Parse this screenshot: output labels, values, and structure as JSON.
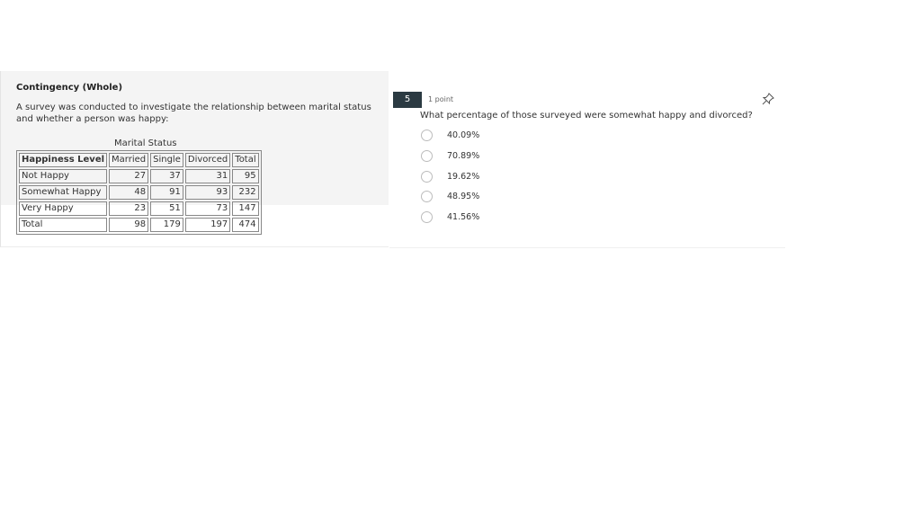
{
  "stimulus": {
    "title": "Contingency (Whole)",
    "description": "A survey was conducted to investigate the relationship between marital status and whether a person was happy:",
    "table_caption": "Marital Status",
    "columns": [
      "Happiness Level",
      "Married",
      "Single",
      "Divorced",
      "Total"
    ],
    "rows": [
      {
        "label": "Not Happy",
        "married": "27",
        "single": "37",
        "divorced": "31",
        "total": "95"
      },
      {
        "label": "Somewhat Happy",
        "married": "48",
        "single": "91",
        "divorced": "93",
        "total": "232"
      },
      {
        "label": "Very Happy",
        "married": "23",
        "single": "51",
        "divorced": "73",
        "total": "147"
      },
      {
        "label": "Total",
        "married": "98",
        "single": "179",
        "divorced": "197",
        "total": "474"
      }
    ]
  },
  "question": {
    "number": "5",
    "points": "1 point",
    "text": "What percentage of those surveyed were somewhat happy and divorced?",
    "options": [
      "40.09%",
      "70.89%",
      "19.62%",
      "48.95%",
      "41.56%"
    ],
    "pin_icon": "pin-icon"
  }
}
